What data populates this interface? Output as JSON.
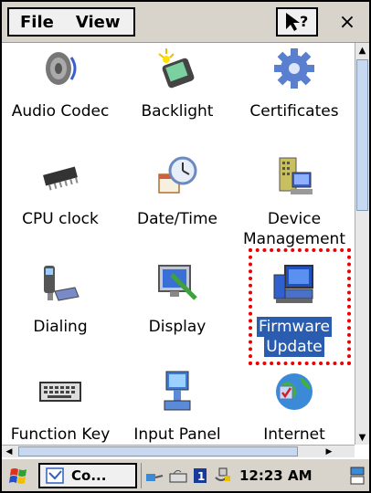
{
  "menubar": {
    "file_label": "File",
    "view_label": "View",
    "close_glyph": "×"
  },
  "items": [
    {
      "name": "audio-codec",
      "label": "Audio Codec",
      "icon": "speaker-icon"
    },
    {
      "name": "backlight",
      "label": "Backlight",
      "icon": "backlight-icon"
    },
    {
      "name": "certificates",
      "label": "Certificates",
      "icon": "gear-icon"
    },
    {
      "name": "cpu-clock",
      "label": "CPU clock",
      "icon": "chip-icon"
    },
    {
      "name": "date-time",
      "label": "Date/Time",
      "icon": "clock-calendar-icon"
    },
    {
      "name": "device-management",
      "label1": "Device",
      "label2": "Management",
      "icon": "server-icon"
    },
    {
      "name": "dialing",
      "label": "Dialing",
      "icon": "phone-icon"
    },
    {
      "name": "display",
      "label": "Display",
      "icon": "monitor-brush-icon"
    },
    {
      "name": "firmware-update",
      "label1": "Firmware",
      "label2": "Update",
      "icon": "computer-update-icon",
      "selected": true
    },
    {
      "name": "function-key",
      "label": "Function Key",
      "icon": "keyboard-icon"
    },
    {
      "name": "input-panel",
      "label": "Input Panel",
      "icon": "input-panel-icon"
    },
    {
      "name": "internet",
      "label": "Internet",
      "icon": "globe-icon"
    }
  ],
  "taskbar": {
    "task_label": "Co...",
    "clock": "12:23 AM"
  },
  "colors": {
    "selection": "#2a5db0",
    "highlight_box": "#e00000",
    "chrome": "#d8d4cc"
  }
}
